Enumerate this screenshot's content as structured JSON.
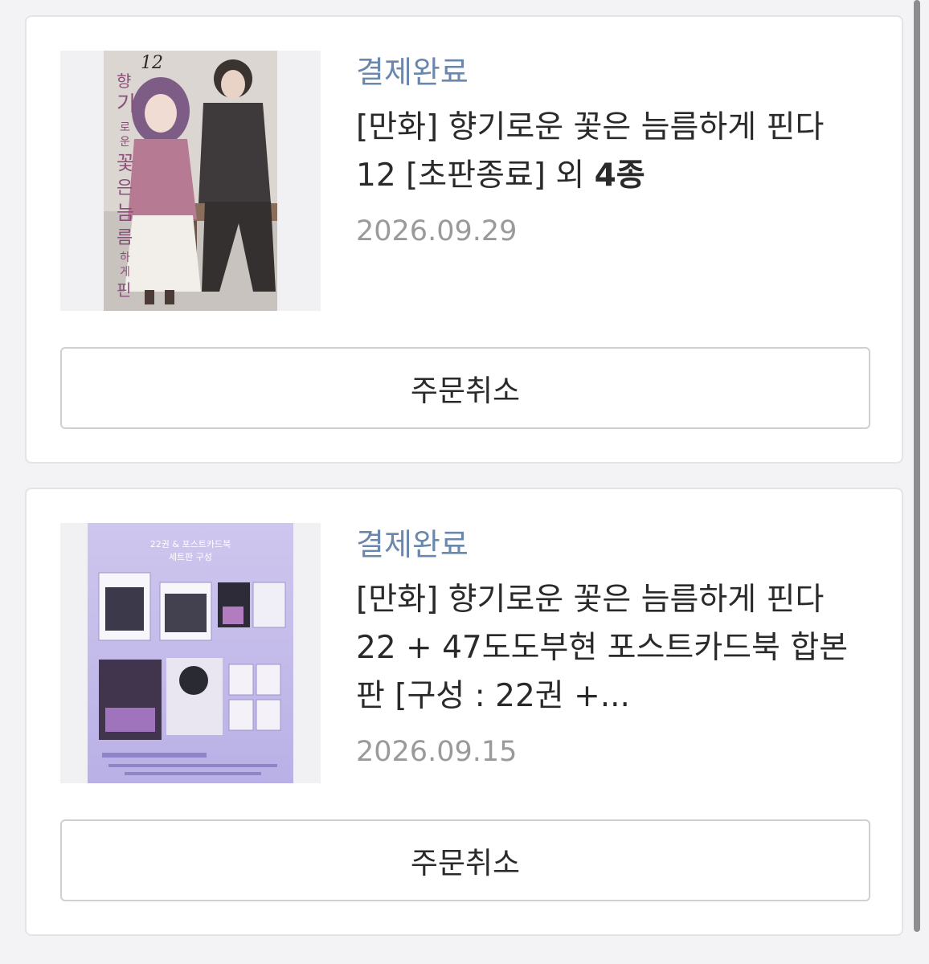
{
  "orders": [
    {
      "status": "결제완료",
      "title_main": "[만화] 향기로운 꽃은 늠름하게 핀다 12 [초판종료] 외 ",
      "title_bold": "4종",
      "date": "2026.09.29",
      "cancel_label": "주문취소",
      "cover": {
        "volume_mark": "12",
        "title_vertical": "향기로운 꽃은 늠름하게 핀다"
      }
    },
    {
      "status": "결제완료",
      "title_main": "[만화] 향기로운 꽃은 늠름하게 핀다 22 + 47도도부현 포스트카드북 합본판 [구성 : 22권 +...",
      "title_bold": "",
      "date": "2026.09.15",
      "cancel_label": "주문취소",
      "cover": {
        "banner_line1": "22권 & 포스트카드북",
        "banner_line2": "세트판 구성"
      }
    }
  ],
  "colors": {
    "status": "#6a87ad",
    "title": "#2a2a2a",
    "date": "#9a9a9a",
    "card_border": "#e4e4e8",
    "button_border": "#cfcfd4",
    "page_bg": "#f3f3f5"
  }
}
